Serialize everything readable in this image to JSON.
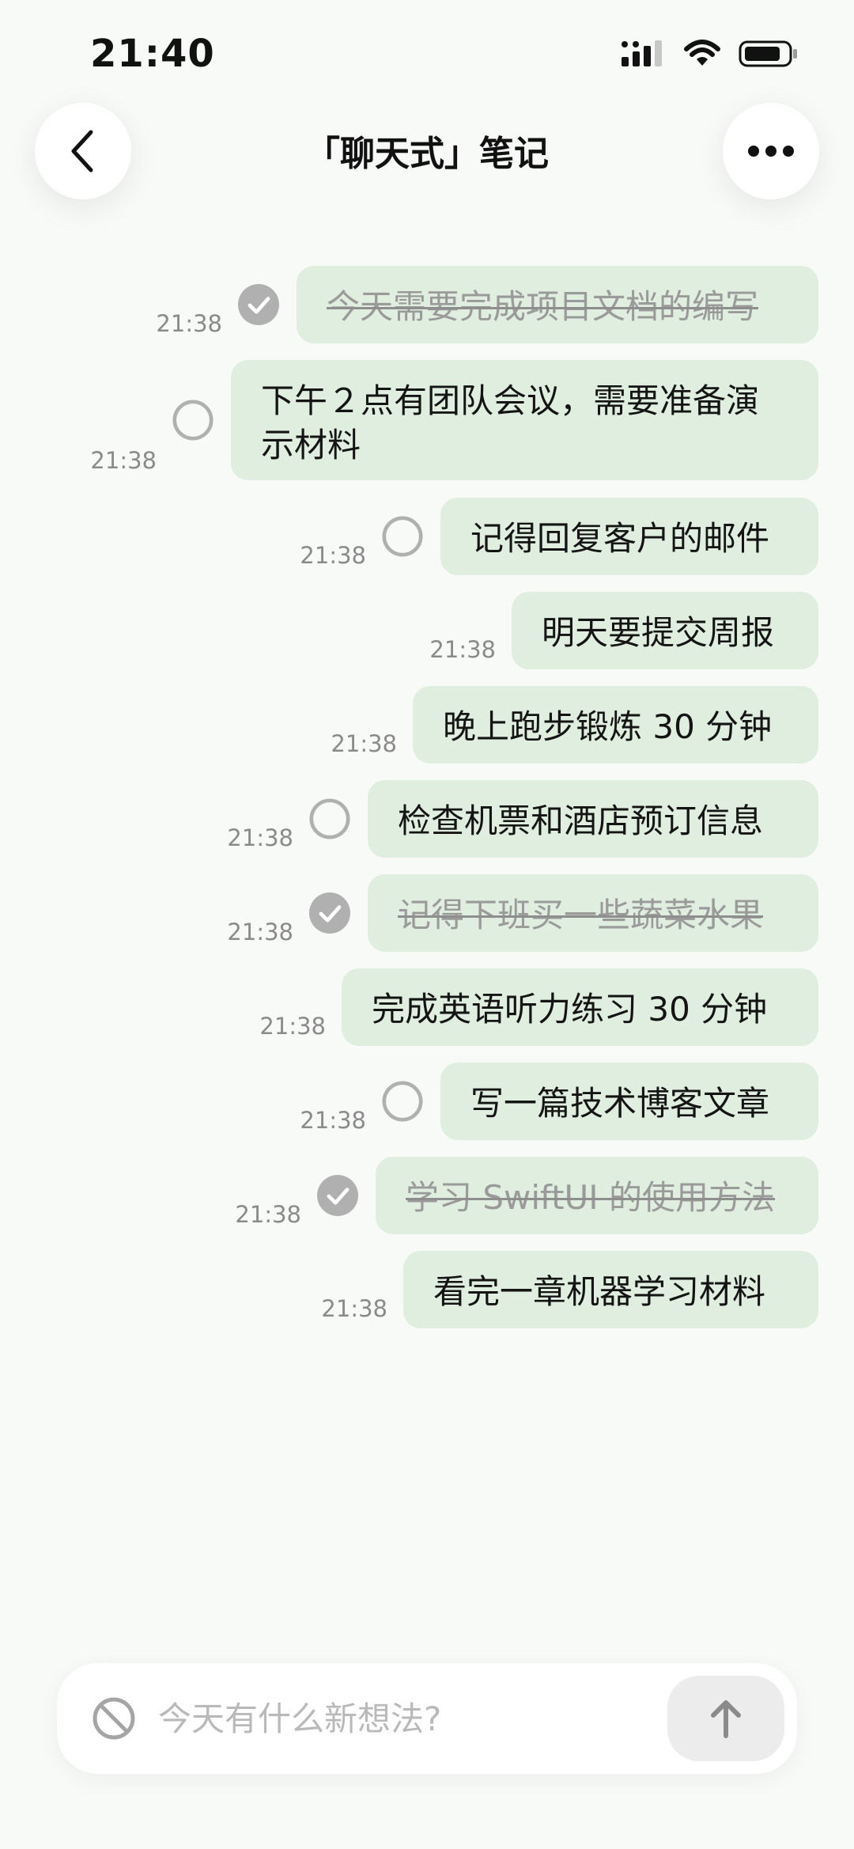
{
  "status_bar": {
    "time": "21:40"
  },
  "header": {
    "title": "「聊天式」笔记",
    "back_icon": "chevron-left-icon",
    "more_icon": "ellipsis-icon"
  },
  "messages": [
    {
      "time": "21:38",
      "text": "今天需要完成项目文档的编写",
      "state": "checked"
    },
    {
      "time": "21:38",
      "text": "下午２点有团队会议，需要准备演示材料",
      "state": "unchecked"
    },
    {
      "time": "21:38",
      "text": "记得回复客户的邮件",
      "state": "unchecked"
    },
    {
      "time": "21:38",
      "text": "明天要提交周报",
      "state": "none"
    },
    {
      "time": "21:38",
      "text": "晚上跑步锻炼 30 分钟",
      "state": "none"
    },
    {
      "time": "21:38",
      "text": "检查机票和酒店预订信息",
      "state": "unchecked"
    },
    {
      "time": "21:38",
      "text": "记得下班买一些蔬菜水果",
      "state": "checked"
    },
    {
      "time": "21:38",
      "text": "完成英语听力练习 30 分钟",
      "state": "none"
    },
    {
      "time": "21:38",
      "text": "写一篇技术博客文章",
      "state": "unchecked"
    },
    {
      "time": "21:38",
      "text": "学习 SwiftUI 的使用方法",
      "state": "checked"
    },
    {
      "time": "21:38",
      "text": "看完一章机器学习材料",
      "state": "none"
    }
  ],
  "composer": {
    "placeholder": "今天有什么新想法?",
    "left_icon": "no-entry-icon",
    "send_icon": "arrow-up-icon"
  },
  "colors": {
    "bubble": "#dfeede",
    "background": "#f8faf8",
    "check": "#b0b0b0"
  }
}
